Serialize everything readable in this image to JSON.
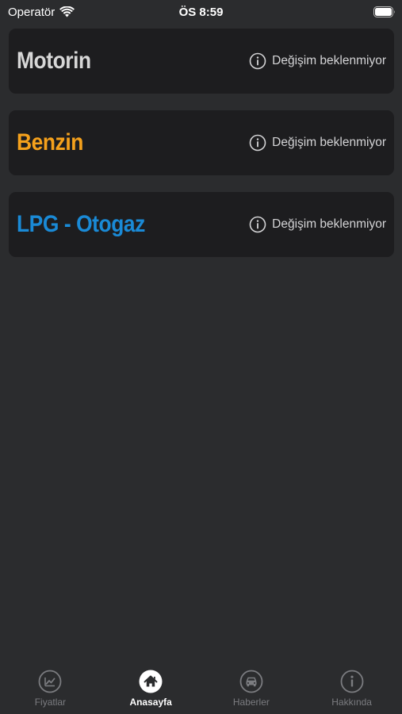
{
  "status_bar": {
    "carrier": "Operatör",
    "time": "ÖS 8:59"
  },
  "colors": {
    "background": "#2b2c2e",
    "card": "#1d1d1f",
    "motorin": "#d7d7d7",
    "benzin": "#f5a11c",
    "lpg": "#1a8ad6",
    "tab_inactive": "#7b7c80",
    "tab_active": "#ffffff"
  },
  "cards": [
    {
      "name": "Motorin",
      "status": "Değişim beklenmiyor",
      "icon": "info-circle-icon"
    },
    {
      "name": "Benzin",
      "status": "Değişim beklenmiyor",
      "icon": "info-circle-icon"
    },
    {
      "name": "LPG - Otogaz",
      "status": "Değişim beklenmiyor",
      "icon": "info-circle-icon"
    }
  ],
  "tabs": [
    {
      "label": "Fiyatlar",
      "icon": "chart-icon",
      "active": false
    },
    {
      "label": "Anasayfa",
      "icon": "home-icon",
      "active": true
    },
    {
      "label": "Haberler",
      "icon": "car-icon",
      "active": false
    },
    {
      "label": "Hakkında",
      "icon": "info-icon",
      "active": false
    }
  ]
}
